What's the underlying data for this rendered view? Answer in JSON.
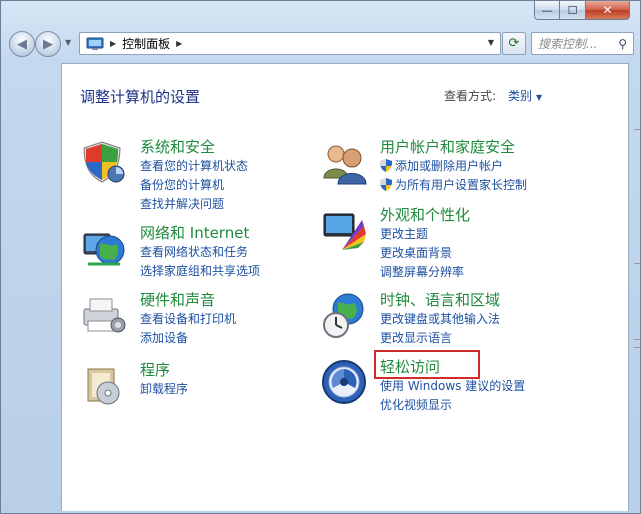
{
  "window": {
    "caption_buttons": {
      "minimize": "—",
      "maximize": "☐",
      "close": "✕"
    }
  },
  "navbar": {
    "address_path": "控制面板",
    "search_placeholder": "搜索控制...",
    "refresh_glyph": "⟳"
  },
  "content": {
    "title": "调整计算机的设置",
    "view_by_label": "查看方式:",
    "view_by_value": "类别",
    "categories": [
      {
        "title": "系统和安全",
        "icon": "system-security-icon",
        "links": [
          "查看您的计算机状态",
          "备份您的计算机",
          "查找并解决问题"
        ]
      },
      {
        "title": "网络和 Internet",
        "icon": "network-icon",
        "links": [
          "查看网络状态和任务",
          "选择家庭组和共享选项"
        ]
      },
      {
        "title": "硬件和声音",
        "icon": "hardware-sound-icon",
        "links": [
          "查看设备和打印机",
          "添加设备"
        ]
      },
      {
        "title": "程序",
        "icon": "programs-icon",
        "links": [
          "卸载程序"
        ]
      },
      {
        "title": "用户帐户和家庭安全",
        "icon": "user-accounts-icon",
        "links": [
          "添加或删除用户帐户",
          "为所有用户设置家长控制"
        ]
      },
      {
        "title": "外观和个性化",
        "icon": "appearance-icon",
        "links": [
          "更改主题",
          "更改桌面背景",
          "调整屏幕分辨率"
        ]
      },
      {
        "title": "时钟、语言和区域",
        "icon": "clock-language-icon",
        "links": [
          "更改键盘或其他输入法",
          "更改显示语言"
        ]
      },
      {
        "title": "轻松访问",
        "icon": "ease-of-access-icon",
        "links": [
          "使用 Windows 建议的设置",
          "优化视频显示"
        ]
      }
    ]
  },
  "colors": {
    "category_title": "#1e8a3c",
    "link": "#1e50a2",
    "highlight": "#d12b2b"
  }
}
